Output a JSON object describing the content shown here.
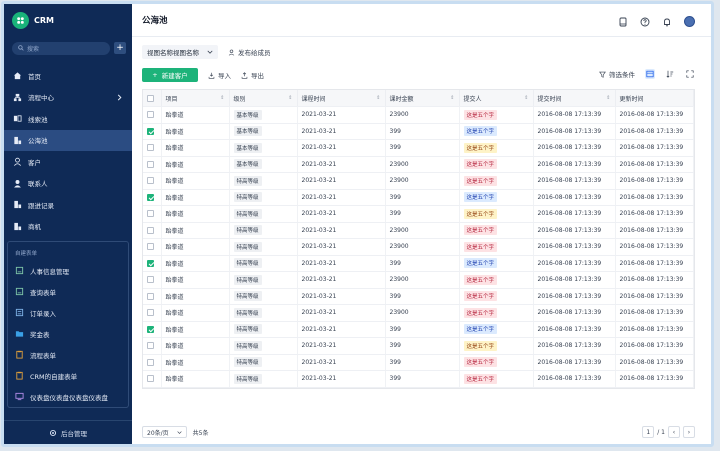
{
  "app": {
    "logo_text": "CRM",
    "accent": "#1db37a",
    "sidebar_bg": "#0f2a56"
  },
  "sidebar": {
    "search_placeholder": "搜索",
    "items": [
      {
        "label": "首页",
        "icon": "home-icon"
      },
      {
        "label": "流程中心",
        "icon": "flow-icon",
        "has_children": true
      },
      {
        "label": "线索池",
        "icon": "leads-icon"
      },
      {
        "label": "公海池",
        "icon": "pool-icon",
        "active": true
      },
      {
        "label": "客户",
        "icon": "customer-icon"
      },
      {
        "label": "联系人",
        "icon": "contact-icon"
      },
      {
        "label": "跟进记录",
        "icon": "record-icon"
      },
      {
        "label": "商机",
        "icon": "opportunity-icon"
      }
    ],
    "custom_title": "自建表单",
    "custom_items": [
      {
        "label": "人事信息管理",
        "icon": "form-icon"
      },
      {
        "label": "查询表单",
        "icon": "form-icon"
      },
      {
        "label": "订单录入",
        "icon": "form-icon"
      },
      {
        "label": "奖金表",
        "icon": "folder-icon"
      },
      {
        "label": "流程表单",
        "icon": "clipboard-icon"
      },
      {
        "label": "CRM的自建表单",
        "icon": "clipboard-icon"
      },
      {
        "label": "仪表盘仪表盘仪表盘仪表盘",
        "icon": "dashboard-icon"
      }
    ],
    "footer_label": "后台管理"
  },
  "header": {
    "title": "公海池"
  },
  "view": {
    "select_label": "视图名称视图名称",
    "members_label": "发布给成员"
  },
  "toolbar": {
    "new_label": "新建客户",
    "import_label": "导入",
    "export_label": "导出",
    "filter_label": "筛选条件"
  },
  "table": {
    "columns": [
      "项目",
      "级别",
      "课程时间",
      "课时金额",
      "提交人",
      "提交时间",
      "更新时间"
    ],
    "rows": [
      {
        "checked": false,
        "project": "跆拳道",
        "level": "基本等级",
        "date": "2021-03-21",
        "amount": "23900",
        "submitter": "这是五个字",
        "color": "pink",
        "submit_time": "2016-08-08 17:13:39",
        "update_time": "2016-08-08 17:13:39"
      },
      {
        "checked": true,
        "project": "跆拳道",
        "level": "基本等级",
        "date": "2021-03-21",
        "amount": "399",
        "submitter": "这是五个字",
        "color": "blue",
        "submit_time": "2016-08-08 17:13:39",
        "update_time": "2016-08-08 17:13:39"
      },
      {
        "checked": false,
        "project": "跆拳道",
        "level": "基本等级",
        "date": "2021-03-21",
        "amount": "399",
        "submitter": "这是五个字",
        "color": "yellow",
        "submit_time": "2016-08-08 17:13:39",
        "update_time": "2016-08-08 17:13:39"
      },
      {
        "checked": false,
        "project": "跆拳道",
        "level": "基本等级",
        "date": "2021-03-21",
        "amount": "23900",
        "submitter": "这是五个字",
        "color": "pink",
        "submit_time": "2016-08-08 17:13:39",
        "update_time": "2016-08-08 17:13:39"
      },
      {
        "checked": false,
        "project": "跆拳道",
        "level": "特高等级",
        "date": "2021-03-21",
        "amount": "23900",
        "submitter": "这是五个字",
        "color": "pink",
        "submit_time": "2016-08-08 17:13:39",
        "update_time": "2016-08-08 17:13:39"
      },
      {
        "checked": true,
        "project": "跆拳道",
        "level": "特高等级",
        "date": "2021-03-21",
        "amount": "399",
        "submitter": "这是五个字",
        "color": "blue",
        "submit_time": "2016-08-08 17:13:39",
        "update_time": "2016-08-08 17:13:39"
      },
      {
        "checked": false,
        "project": "跆拳道",
        "level": "特高等级",
        "date": "2021-03-21",
        "amount": "399",
        "submitter": "这是五个字",
        "color": "yellow",
        "submit_time": "2016-08-08 17:13:39",
        "update_time": "2016-08-08 17:13:39"
      },
      {
        "checked": false,
        "project": "跆拳道",
        "level": "特高等级",
        "date": "2021-03-21",
        "amount": "23900",
        "submitter": "这是五个字",
        "color": "pink",
        "submit_time": "2016-08-08 17:13:39",
        "update_time": "2016-08-08 17:13:39"
      },
      {
        "checked": false,
        "project": "跆拳道",
        "level": "特高等级",
        "date": "2021-03-21",
        "amount": "23900",
        "submitter": "这是五个字",
        "color": "pink",
        "submit_time": "2016-08-08 17:13:39",
        "update_time": "2016-08-08 17:13:39"
      },
      {
        "checked": true,
        "project": "跆拳道",
        "level": "特高等级",
        "date": "2021-03-21",
        "amount": "399",
        "submitter": "这是五个字",
        "color": "blue",
        "submit_time": "2016-08-08 17:13:39",
        "update_time": "2016-08-08 17:13:39"
      },
      {
        "checked": false,
        "project": "跆拳道",
        "level": "特高等级",
        "date": "2021-03-21",
        "amount": "23900",
        "submitter": "这是五个字",
        "color": "pink",
        "submit_time": "2016-08-08 17:13:39",
        "update_time": "2016-08-08 17:13:39"
      },
      {
        "checked": false,
        "project": "跆拳道",
        "level": "特高等级",
        "date": "2021-03-21",
        "amount": "399",
        "submitter": "这是五个字",
        "color": "pink",
        "submit_time": "2016-08-08 17:13:39",
        "update_time": "2016-08-08 17:13:39"
      },
      {
        "checked": false,
        "project": "跆拳道",
        "level": "特高等级",
        "date": "2021-03-21",
        "amount": "23900",
        "submitter": "这是五个字",
        "color": "pink",
        "submit_time": "2016-08-08 17:13:39",
        "update_time": "2016-08-08 17:13:39"
      },
      {
        "checked": true,
        "project": "跆拳道",
        "level": "特高等级",
        "date": "2021-03-21",
        "amount": "399",
        "submitter": "这是五个字",
        "color": "blue",
        "submit_time": "2016-08-08 17:13:39",
        "update_time": "2016-08-08 17:13:39"
      },
      {
        "checked": false,
        "project": "跆拳道",
        "level": "特高等级",
        "date": "2021-03-21",
        "amount": "399",
        "submitter": "这是五个字",
        "color": "yellow",
        "submit_time": "2016-08-08 17:13:39",
        "update_time": "2016-08-08 17:13:39"
      },
      {
        "checked": false,
        "project": "跆拳道",
        "level": "特高等级",
        "date": "2021-03-21",
        "amount": "399",
        "submitter": "这是五个字",
        "color": "pink",
        "submit_time": "2016-08-08 17:13:39",
        "update_time": "2016-08-08 17:13:39"
      },
      {
        "checked": false,
        "project": "跆拳道",
        "level": "特高等级",
        "date": "2021-03-21",
        "amount": "399",
        "submitter": "这是五个字",
        "color": "pink",
        "submit_time": "2016-08-08 17:13:39",
        "update_time": "2016-08-08 17:13:39"
      }
    ]
  },
  "footer": {
    "page_size": "20条/页",
    "total": "共5条",
    "current_page": "1",
    "total_pages": "/ 1"
  }
}
